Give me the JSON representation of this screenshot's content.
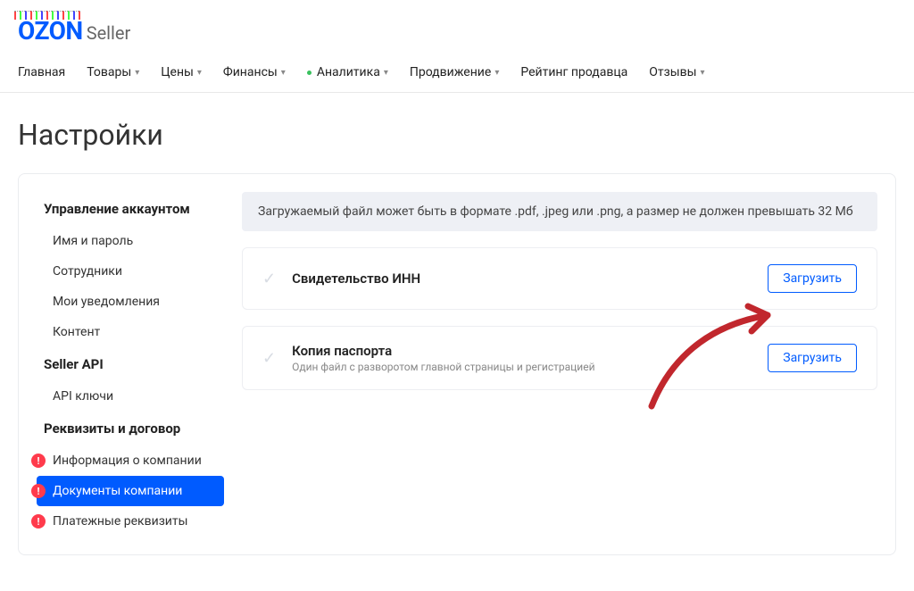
{
  "logo": {
    "brand": "OZON",
    "sub": "Seller"
  },
  "nav": [
    {
      "label": "Главная",
      "dropdown": false
    },
    {
      "label": "Товары",
      "dropdown": true
    },
    {
      "label": "Цены",
      "dropdown": true
    },
    {
      "label": "Финансы",
      "dropdown": true
    },
    {
      "label": "Аналитика",
      "dropdown": true,
      "dot": true
    },
    {
      "label": "Продвижение",
      "dropdown": true
    },
    {
      "label": "Рейтинг продавца",
      "dropdown": false
    },
    {
      "label": "Отзывы",
      "dropdown": true
    }
  ],
  "page_title": "Настройки",
  "sidebar": {
    "section1": {
      "title": "Управление аккаунтом",
      "items": [
        "Имя и пароль",
        "Сотрудники",
        "Мои уведомления",
        "Контент"
      ]
    },
    "section2": {
      "title": "Seller API",
      "items": [
        "API ключи"
      ]
    },
    "section3": {
      "title": "Реквизиты и договор",
      "items": [
        {
          "label": "Информация о компании",
          "warn": true
        },
        {
          "label": "Документы компании",
          "warn": true,
          "active": true
        },
        {
          "label": "Платежные реквизиты",
          "warn": true
        }
      ]
    }
  },
  "notice": "Загружаемый файл может быть в формате .pdf, .jpeg или .png, а размер не должен превышать 32 Мб",
  "documents": [
    {
      "title": "Свидетельство ИНН",
      "sub": "",
      "button": "Загрузить"
    },
    {
      "title": "Копия паспорта",
      "sub": "Один файл с разворотом главной страницы и регистрацией",
      "button": "Загрузить"
    }
  ]
}
